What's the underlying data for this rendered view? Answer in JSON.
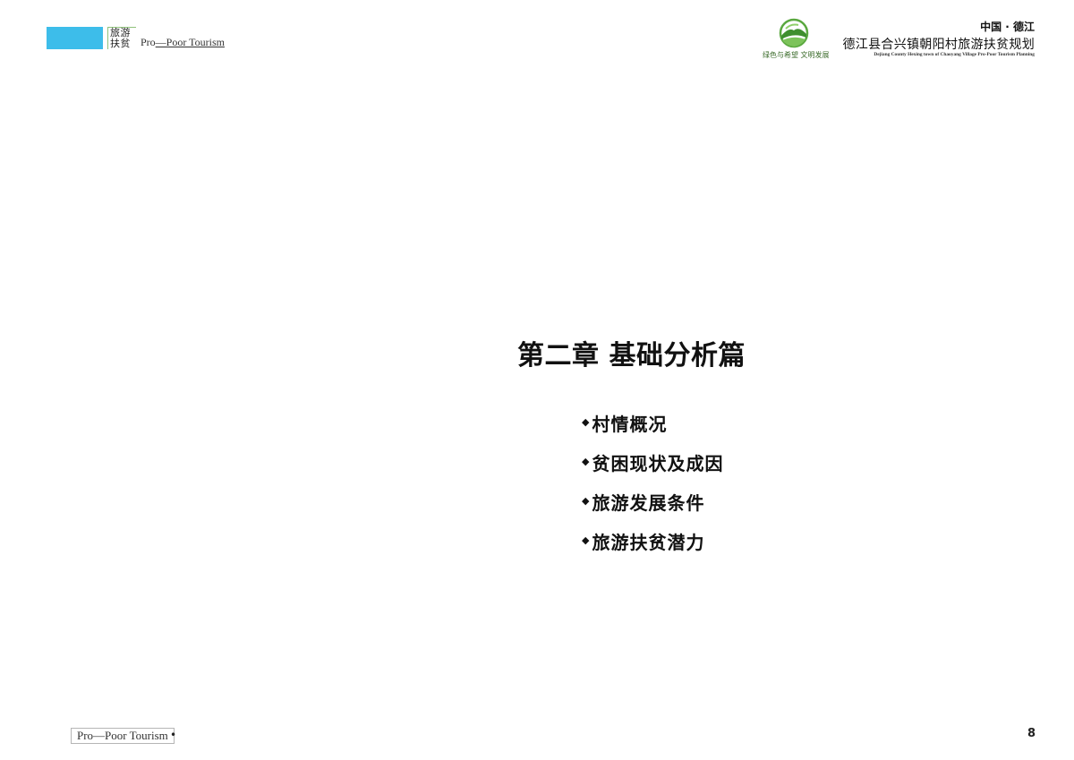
{
  "header": {
    "brand_color": "#3dbdea",
    "stamp_line1": "旅游",
    "stamp_line2": "扶贫",
    "brand_prefix": "Pro",
    "brand_suffix": "—Poor Tourism",
    "logo_caption": "绿色与希望 文明发展",
    "region": "中国 · 德江",
    "project_title": "德江县合兴镇朝阳村旅游扶贫规划",
    "project_subtitle": "Dejiang County Hexing town of Chaoyang Village Pro-Poor Tourism Planning"
  },
  "main": {
    "chapter_title": "第二章  基础分析篇",
    "bullet_glyph": "◆",
    "items": [
      {
        "label": "村情概况"
      },
      {
        "label": "贫困现状及成因"
      },
      {
        "label": "旅游发展条件"
      },
      {
        "label": "旅游扶贫潜力"
      }
    ]
  },
  "footer": {
    "brand": "Pro—Poor Tourism",
    "dot": "•",
    "page_number": "8"
  }
}
